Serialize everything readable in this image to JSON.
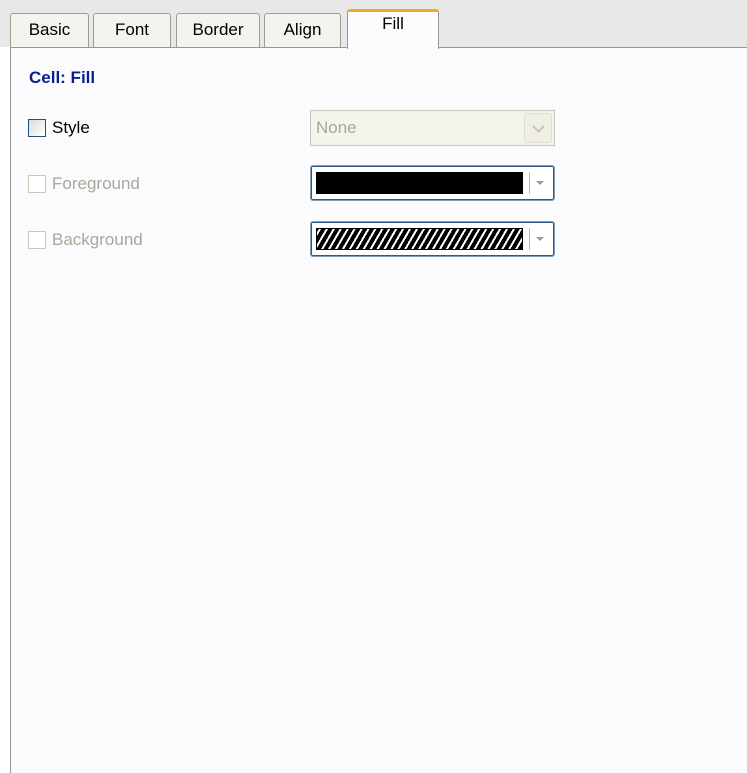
{
  "tabs": [
    {
      "label": "Basic",
      "active": false
    },
    {
      "label": "Font",
      "active": false
    },
    {
      "label": "Border",
      "active": false
    },
    {
      "label": "Align",
      "active": false
    },
    {
      "label": "Fill",
      "active": true
    }
  ],
  "section": {
    "title": "Cell: Fill"
  },
  "fields": {
    "style": {
      "label": "Style",
      "checked": false,
      "enabled": true,
      "value": "None",
      "dropdown_enabled": false
    },
    "foreground": {
      "label": "Foreground",
      "checked": false,
      "enabled": false,
      "color": "#000000",
      "pattern": "solid"
    },
    "background": {
      "label": "Background",
      "checked": false,
      "enabled": false,
      "color": "#000000",
      "pattern": "diagonal-hatch"
    }
  },
  "colors": {
    "section_title": "#0b1f89",
    "active_tab_accent": "#f0a830",
    "disabled_text": "#a8a79c",
    "panel_background": "#fbfbfd"
  }
}
